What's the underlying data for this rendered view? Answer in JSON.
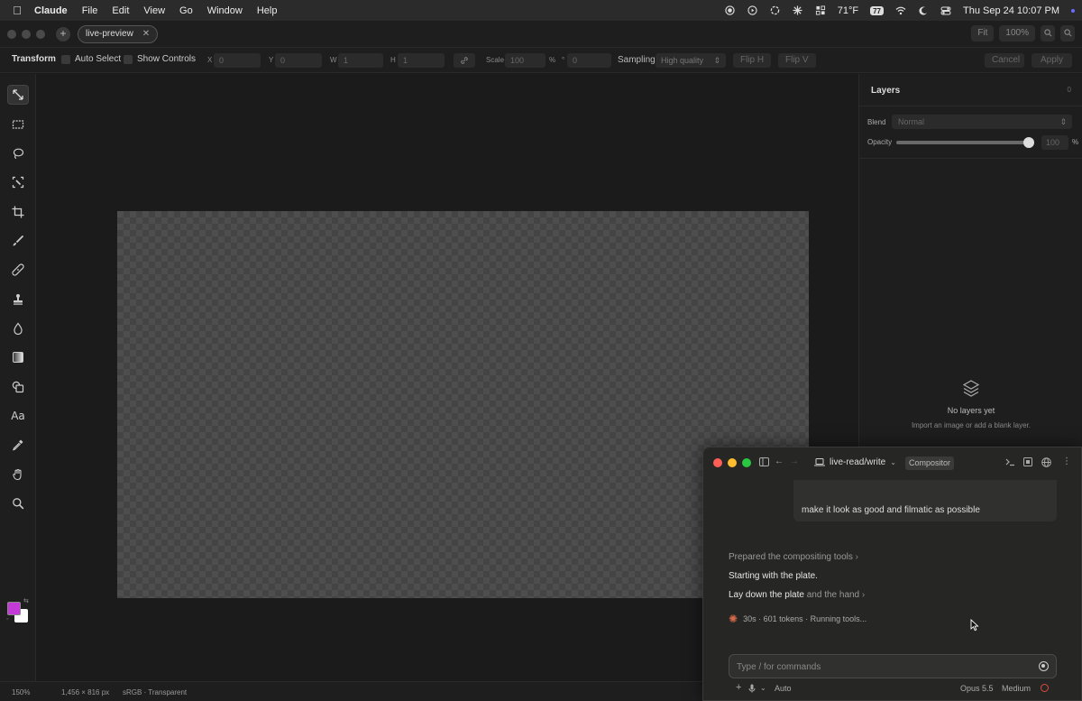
{
  "menubar": {
    "app": "Claude",
    "menus": [
      "File",
      "Edit",
      "View",
      "Go",
      "Window",
      "Help"
    ],
    "weather": "71°F",
    "battery": "77",
    "datetime": "Thu Sep 24  10:07 PM"
  },
  "titlebar": {
    "tab_label": "live-preview",
    "fit_label": "Fit",
    "zoom_label": "100%"
  },
  "options": {
    "title": "Transform",
    "auto_select": "Auto Select",
    "show_controls": "Show Controls",
    "x_label": "X",
    "x_value": "0",
    "y_label": "Y",
    "y_value": "0",
    "w_label": "W",
    "w_value": "1",
    "h_label": "H",
    "h_value": "1",
    "scale_label": "Scale",
    "scale_value": "100",
    "scale_unit": "%",
    "rotate_label": "°",
    "rotate_value": "0",
    "sampling_label": "Sampling",
    "sampling_value": "High quality",
    "flip_h": "Flip H",
    "flip_v": "Flip V",
    "cancel": "Cancel",
    "apply": "Apply"
  },
  "tools": [
    "move-transform",
    "marquee",
    "lasso",
    "magic-select",
    "crop",
    "brush",
    "healing",
    "stamp",
    "blur",
    "gradient",
    "shapes",
    "text",
    "eyedropper",
    "smudge",
    "zoom"
  ],
  "colors": {
    "foreground": "#c43ad8",
    "background": "#ffffff"
  },
  "layers": {
    "title": "Layers",
    "count": "0",
    "blend_label": "Blend",
    "blend_value": "Normal",
    "opacity_label": "Opacity",
    "opacity_value": "100",
    "opacity_unit": "%",
    "empty_title": "No layers yet",
    "empty_subtitle": "Import an image or add a blank layer."
  },
  "status": {
    "zoom": "150%",
    "dimensions": "1,456 × 816 px",
    "colorspace": "sRGB · Transparent"
  },
  "claude": {
    "project": "live-read/write",
    "badge": "Compositor",
    "user_message": "make it look as good and filmatic as possible",
    "step1": "Prepared the compositing tools",
    "step2": "Starting with the plate.",
    "step3_a": "Lay down the plate",
    "step3_b": "and the hand",
    "status": "30s · 601 tokens · Running tools...",
    "input_placeholder": "Type / for commands",
    "mode": "Auto",
    "model": "Opus 5.5",
    "effort": "Medium"
  }
}
